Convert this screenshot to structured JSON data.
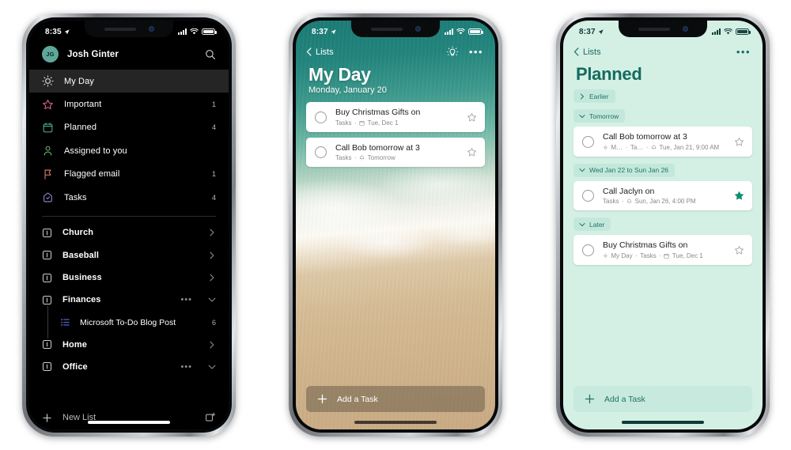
{
  "phones": [
    {
      "id": "phone-sidebar",
      "theme": "dark",
      "status": {
        "time": "8:35",
        "location_icon": "location-arrow-icon",
        "signal": "signal-bars-icon",
        "wifi": "wifi-icon",
        "battery": "battery-icon"
      },
      "account": {
        "initials": "JG",
        "name": "Josh Ginter",
        "search_icon": "search-icon"
      },
      "smart_lists": [
        {
          "label": "My Day",
          "count": "",
          "icon": "sun-icon",
          "color": "#d8d8d8",
          "selected": true
        },
        {
          "label": "Important",
          "count": "1",
          "icon": "star-icon",
          "color": "#e06a86",
          "selected": false
        },
        {
          "label": "Planned",
          "count": "4",
          "icon": "calendar-icon",
          "color": "#4cb79f",
          "selected": false
        },
        {
          "label": "Assigned to you",
          "count": "",
          "icon": "person-icon",
          "color": "#6fbf73",
          "selected": false
        },
        {
          "label": "Flagged email",
          "count": "1",
          "icon": "flag-icon",
          "color": "#e6836b",
          "selected": false
        },
        {
          "label": "Tasks",
          "count": "4",
          "icon": "house-check-icon",
          "color": "#9b8cd6",
          "selected": false
        }
      ],
      "lists": [
        {
          "label": "Church",
          "type": "group",
          "trailing": "chevron-right-icon",
          "has_dots": false
        },
        {
          "label": "Baseball",
          "type": "group",
          "trailing": "chevron-right-icon",
          "has_dots": false
        },
        {
          "label": "Business",
          "type": "group",
          "trailing": "chevron-right-icon",
          "has_dots": false
        },
        {
          "label": "Finances",
          "type": "group",
          "trailing": "chevron-down-icon",
          "has_dots": true
        },
        {
          "label": "Microsoft To-Do Blog Post",
          "type": "sub",
          "count": "6",
          "icon": "list-icon",
          "color": "#5b6ee8"
        },
        {
          "label": "Home",
          "type": "group",
          "trailing": "chevron-right-icon",
          "has_dots": false
        },
        {
          "label": "Office",
          "type": "group",
          "trailing": "chevron-down-icon",
          "has_dots": true
        }
      ],
      "footer": {
        "new_list_label": "New List",
        "plus_icon": "plus-icon",
        "new_group_icon": "new-group-icon"
      },
      "dots_glyph": "•••"
    },
    {
      "id": "phone-my-day",
      "theme": "beach",
      "status": {
        "time": "8:37",
        "location_icon": "location-arrow-icon"
      },
      "nav": {
        "back_label": "Lists",
        "back_icon": "chevron-left-icon",
        "suggestions_icon": "lightbulb-icon",
        "more_icon": "ellipsis-icon"
      },
      "header": {
        "title": "My Day",
        "subtitle": "Monday, January 20"
      },
      "tasks": [
        {
          "title": "Buy Christmas Gifts on",
          "meta": "Tasks",
          "meta_icon": "calendar-icon",
          "meta_date": "Tue, Dec 1",
          "starred": false
        },
        {
          "title": "Call Bob tomorrow at 3",
          "meta": "Tasks",
          "meta_icon": "bell-icon",
          "meta_date": "Tomorrow",
          "starred": false
        }
      ],
      "add_task": {
        "label": "Add a Task",
        "icon": "plus-icon"
      }
    },
    {
      "id": "phone-planned",
      "theme": "mint",
      "status": {
        "time": "8:37",
        "location_icon": "location-arrow-icon"
      },
      "nav": {
        "back_label": "Lists",
        "back_icon": "chevron-left-icon",
        "more_icon": "ellipsis-icon"
      },
      "header": {
        "title": "Planned"
      },
      "groups": [
        {
          "label": "Earlier",
          "expanded": false,
          "chevron": "chevron-right-icon",
          "tasks": []
        },
        {
          "label": "Tomorrow",
          "expanded": true,
          "chevron": "chevron-down-icon",
          "tasks": [
            {
              "title": "Call Bob tomorrow at 3",
              "meta_parts": [
                "M…",
                "Ta…"
              ],
              "meta_icon": "bell-icon",
              "meta_date": "Tue, Jan 21, 9:00 AM",
              "starred": false,
              "lead_icon": "sun-icon"
            }
          ]
        },
        {
          "label": "Wed Jan 22 to Sun Jan 26",
          "expanded": true,
          "chevron": "chevron-down-icon",
          "tasks": [
            {
              "title": "Call Jaclyn on",
              "meta_parts": [
                "Tasks"
              ],
              "meta_icon": "bell-icon",
              "meta_date": "Sun, Jan 26, 4:00 PM",
              "starred": true,
              "lead_icon": ""
            }
          ]
        },
        {
          "label": "Later",
          "expanded": true,
          "chevron": "chevron-down-icon",
          "tasks": [
            {
              "title": "Buy Christmas Gifts on",
              "meta_parts": [
                "My Day",
                "Tasks"
              ],
              "meta_icon": "calendar-icon",
              "meta_date": "Tue, Dec 1",
              "starred": false,
              "lead_icon": "sun-icon"
            }
          ]
        }
      ],
      "add_task": {
        "label": "Add a Task",
        "icon": "plus-icon"
      },
      "star_color": "#0f8c72"
    }
  ]
}
